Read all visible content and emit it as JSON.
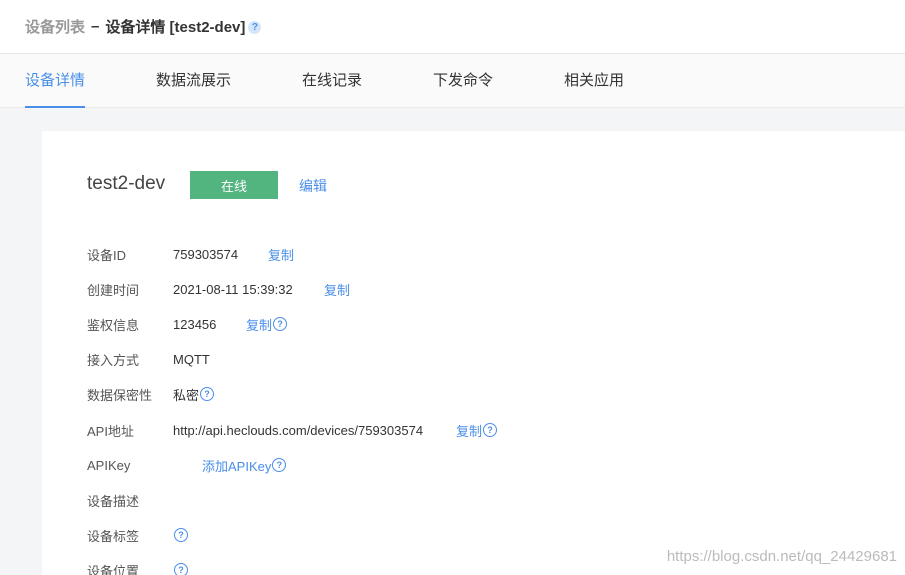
{
  "breadcrumb": {
    "root": "设备列表",
    "separator": "–",
    "current": "设备详情 [test2-dev]",
    "help": "?"
  },
  "tabs": [
    {
      "label": "设备详情",
      "active": true
    },
    {
      "label": "数据流展示",
      "active": false
    },
    {
      "label": "在线记录",
      "active": false
    },
    {
      "label": "下发命令",
      "active": false
    },
    {
      "label": "相关应用",
      "active": false
    }
  ],
  "device": {
    "name": "test2-dev",
    "status": "在线",
    "edit_label": "编辑"
  },
  "details": {
    "device_id": {
      "label": "设备ID",
      "value": "759303574",
      "action": "复制"
    },
    "created": {
      "label": "创建时间",
      "value": "2021-08-11 15:39:32",
      "action": "复制"
    },
    "auth": {
      "label": "鉴权信息",
      "value": "123456",
      "action": "复制"
    },
    "protocol": {
      "label": "接入方式",
      "value": "MQTT"
    },
    "privacy": {
      "label": "数据保密性",
      "value": "私密"
    },
    "api_url": {
      "label": "API地址",
      "value": "http://api.heclouds.com/devices/759303574",
      "action": "复制"
    },
    "apikey": {
      "label": "APIKey",
      "action": "添加APIKey"
    },
    "description": {
      "label": "设备描述"
    },
    "tags": {
      "label": "设备标签"
    },
    "location": {
      "label": "设备位置"
    }
  },
  "help_glyph": "?",
  "watermark": "https://blog.csdn.net/qq_24429681",
  "colors": {
    "accent": "#4a8ee8",
    "online": "#52b47f"
  }
}
